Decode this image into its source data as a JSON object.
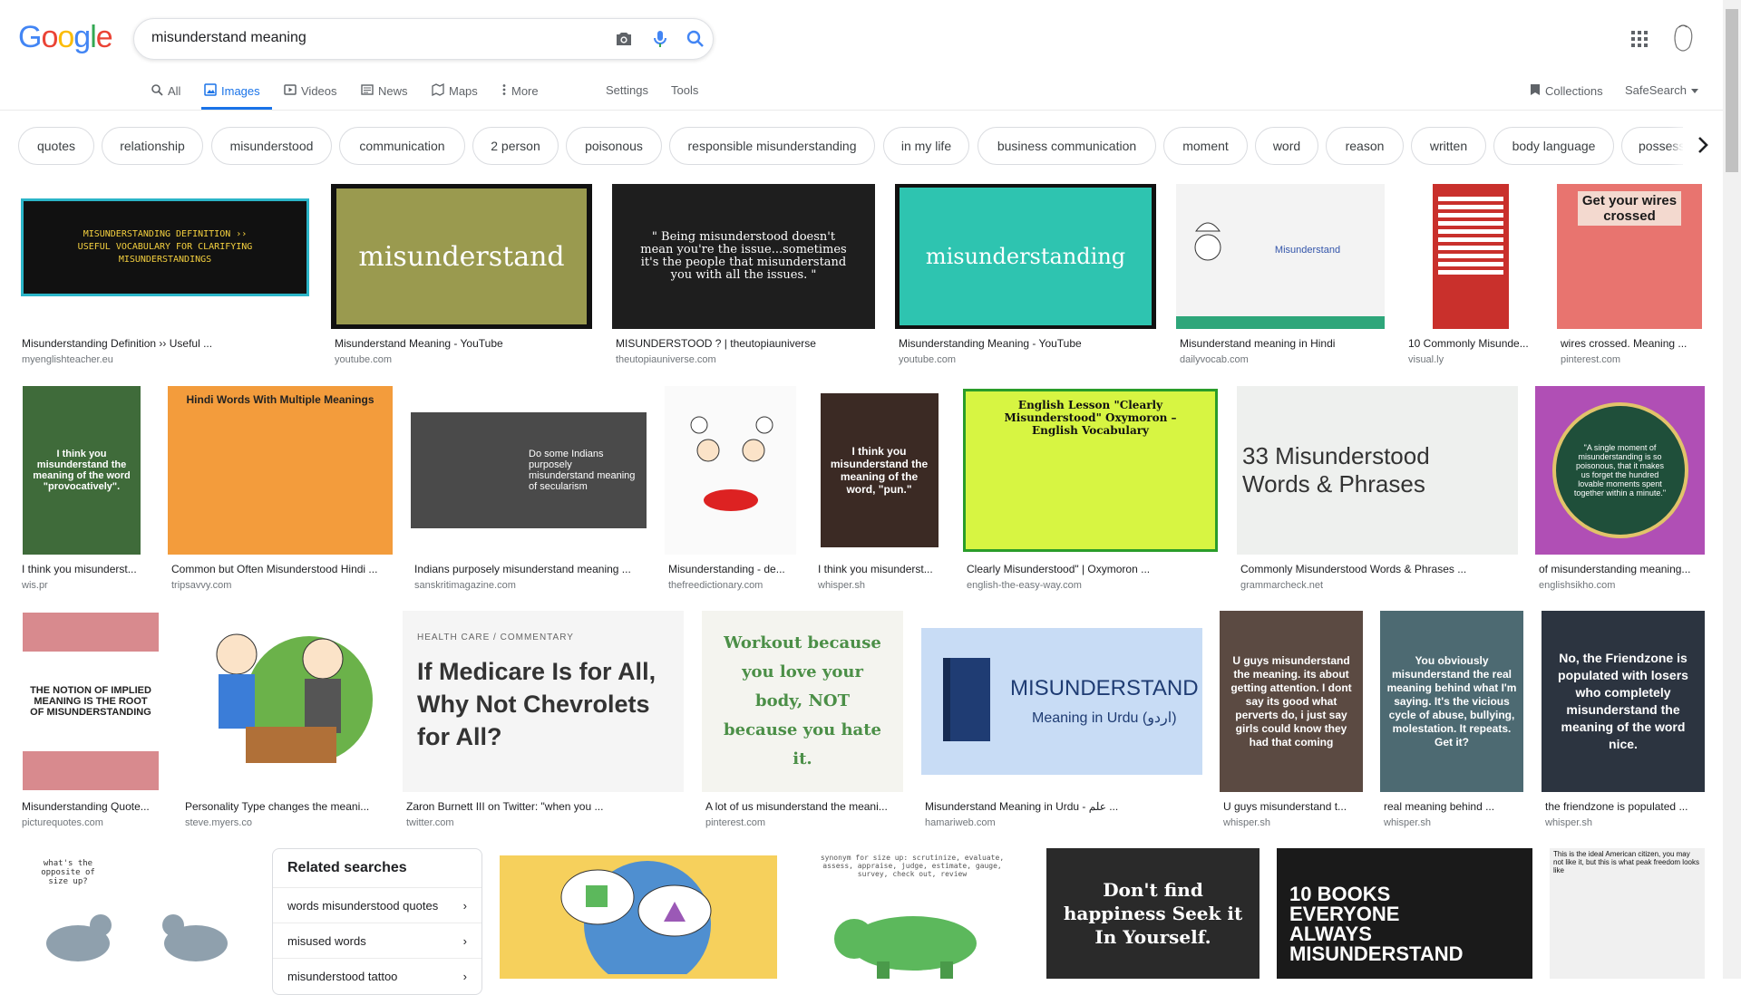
{
  "logo": {
    "letters": [
      "G",
      "o",
      "o",
      "g",
      "l",
      "e"
    ],
    "colors": [
      "#4285f4",
      "#ea4335",
      "#fbbc05",
      "#4285f4",
      "#34a853",
      "#ea4335"
    ]
  },
  "search": {
    "query": "misunderstand meaning"
  },
  "nav": {
    "tabs": [
      "All",
      "Images",
      "Videos",
      "News",
      "Maps",
      "More"
    ],
    "settings": "Settings",
    "tools": "Tools",
    "collections": "Collections",
    "safesearch": "SafeSearch"
  },
  "chips": [
    "quotes",
    "relationship",
    "misunderstood",
    "communication",
    "2 person",
    "poisonous",
    "responsible misunderstanding",
    "in my life",
    "business communication",
    "moment",
    "word",
    "reason",
    "written",
    "body language",
    "possessi"
  ],
  "results_row1": [
    {
      "title": "Misunderstanding Definition ›› Useful ...",
      "source": "myenglishteacher.eu",
      "thumb_text": "MISUNDERSTANDING DEFINITION ›› USEFUL VOCABULARY FOR CLARIFYING MISUNDERSTANDINGS",
      "bg": "#111",
      "fg": "#f4d03f"
    },
    {
      "title": "Misunderstand Meaning - YouTube",
      "source": "youtube.com",
      "thumb_text": "misunderstand",
      "bg": "#9a9a4f",
      "fg": "#ffffff"
    },
    {
      "title": "MISUNDERSTOOD ? | theutopiauniverse",
      "source": "theutopiauniverse.com",
      "thumb_text": "\" Being misunderstood doesn't mean you're the issue...sometimes it's the people that misunderstand you with all the issues. \"",
      "bg": "#1e1e1e",
      "fg": "#ffffff"
    },
    {
      "title": "Misunderstanding Meaning - YouTube",
      "source": "youtube.com",
      "thumb_text": "misunderstanding",
      "bg": "#2ec4b0",
      "fg": "#ffffff"
    },
    {
      "title": "Misunderstand meaning in Hindi",
      "source": "dailyvocab.com",
      "thumb_text": "Misunderstand",
      "bg": "#f3f3f3",
      "fg": "#333"
    },
    {
      "title": "10 Commonly Misunde...",
      "source": "visual.ly",
      "thumb_text": "",
      "bg": "#c9302c",
      "fg": "#fff"
    },
    {
      "title": "wires crossed. Meaning ...",
      "source": "pinterest.com",
      "thumb_text": "Get your wires crossed",
      "bg": "#e8746f",
      "fg": "#1a1a1a"
    }
  ],
  "results_row2": [
    {
      "title": "I think you misunderst...",
      "source": "wis.pr",
      "thumb_text": "I think you misunderstand the meaning of the word \"provocatively\".",
      "bg": "#3f6b3a",
      "fg": "#fff"
    },
    {
      "title": "Common but Often Misunderstood Hindi ...",
      "source": "tripsavvy.com",
      "thumb_text": "Hindi Words With Multiple Meanings",
      "bg": "#f39c3c",
      "fg": "#222"
    },
    {
      "title": "Indians purposely misunderstand meaning ...",
      "source": "sanskritimagazine.com",
      "thumb_text": "Do some Indians purposely misunderstand meaning of secularism",
      "bg": "#4a4a4a",
      "fg": "#fff"
    },
    {
      "title": "Misunderstanding - de...",
      "source": "thefreedictionary.com",
      "thumb_text": "",
      "bg": "#fafafa",
      "fg": "#333"
    },
    {
      "title": "I think you misunderst...",
      "source": "whisper.sh",
      "thumb_text": "I think you misunderstand the meaning of the word, \"pun.\"",
      "bg": "#3b2a24",
      "fg": "#fff"
    },
    {
      "title": "Clearly Misunderstood\" | Oxymoron ...",
      "source": "english-the-easy-way.com",
      "thumb_text": "English Lesson \"Clearly Misunderstood\" Oxymoron – English Vocabulary",
      "bg": "#d7f542",
      "fg": "#111"
    },
    {
      "title": "Commonly Misunderstood Words & Phrases ...",
      "source": "grammarcheck.net",
      "thumb_text": "33 Misunderstood Words & Phrases",
      "bg": "#eef0ee",
      "fg": "#333"
    },
    {
      "title": "of misunderstanding meaning...",
      "source": "englishsikho.com",
      "thumb_text": "\"A single moment of misunderstanding is so poisonous, that it makes us forget the hundred lovable moments spent together within a minute.\"",
      "bg": "#b04fb5",
      "fg": "#fff"
    }
  ],
  "results_row3": [
    {
      "title": "Misunderstanding Quote...",
      "source": "picturequotes.com",
      "thumb_text": "THE NOTION OF IMPLIED MEANING IS THE ROOT OF MISUNDERSTANDING",
      "bg": "#d88a8e",
      "fg": "#222"
    },
    {
      "title": "Personality Type changes the meani...",
      "source": "steve.myers.co",
      "thumb_text": "",
      "bg": "#6bb24a",
      "fg": "#222"
    },
    {
      "title": "Zaron Burnett III on Twitter: \"when you ...",
      "source": "twitter.com",
      "thumb_text": "If Medicare Is for All, Why Not Chevrolets for All?",
      "label": "HEALTH CARE / COMMENTARY",
      "bg": "#f5f5f5",
      "fg": "#333"
    },
    {
      "title": "A lot of us misunderstand the meani...",
      "source": "pinterest.com",
      "thumb_text": "Workout because you love your body, NOT because you hate it.",
      "bg": "#f4f4ef",
      "fg": "#4b8f47"
    },
    {
      "title": "Misunderstand Meaning in Urdu - علم ...",
      "source": "hamariweb.com",
      "thumb_text": "MISUNDERSTAND",
      "subtext": "Meaning in Urdu (اردو)",
      "bg": "#c8dcf5",
      "fg": "#1f3c73"
    },
    {
      "title": "U guys misunderstand t...",
      "source": "whisper.sh",
      "thumb_text": "U guys misunderstand the meaning. its about getting attention. I dont say its good what perverts do, i just say girls could know they had that coming",
      "bg": "#5b4a42",
      "fg": "#fff"
    },
    {
      "title": "real meaning behind ...",
      "source": "whisper.sh",
      "thumb_text": "You obviously misunderstand the real meaning behind what I'm saying. It's the vicious cycle of abuse, bullying, molestation. It repeats. Get it?",
      "bg": "#4d6a72",
      "fg": "#fff"
    },
    {
      "title": "the friendzone is populated ...",
      "source": "whisper.sh",
      "thumb_text": "No, the Friendzone is populated with losers who completely misunderstand the meaning of the word nice.",
      "bg": "#2c3440",
      "fg": "#fff"
    }
  ],
  "related": {
    "title": "Related searches",
    "items": [
      "words misunderstood quotes",
      "misused words",
      "misunderstood tattoo"
    ]
  },
  "results_row4": [
    {
      "thumb_text": "what's the opposite of size up?",
      "bg": "#ffffff",
      "fg": "#333"
    },
    {
      "thumb_text": "",
      "bg": "#f6d05c",
      "fg": "#333"
    },
    {
      "thumb_text": "synonym for size up: scrutinize, evaluate, assess, appraise, judge, estimate, gauge, survey, check out, review",
      "bg": "#ffffff",
      "fg": "#555"
    },
    {
      "thumb_text": "Don't find happiness Seek it In Yourself.",
      "bg": "#2a2a2a",
      "fg": "#fff"
    },
    {
      "thumb_text": "10 BOOKS EVERYONE ALWAYS MISUNDERSTAND",
      "bg": "#1a1a1a",
      "fg": "#e8e234"
    },
    {
      "thumb_text": "This is the ideal American citizen, you may not like it, but this is what peak freedom looks like",
      "bg": "#f0f0f0",
      "fg": "#111"
    }
  ]
}
